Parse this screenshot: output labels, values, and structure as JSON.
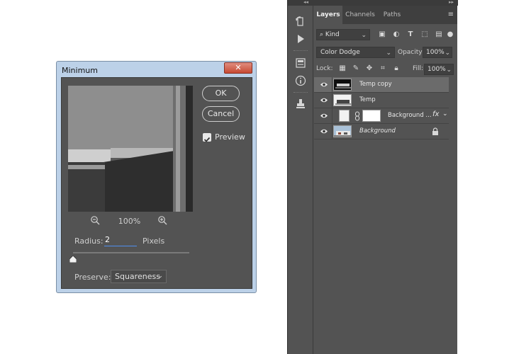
{
  "dialog": {
    "title": "Minimum",
    "close_label": "✕",
    "ok_label": "OK",
    "cancel_label": "Cancel",
    "preview_label": "Preview",
    "preview_checked": true,
    "zoom_value": "100%",
    "radius_label": "Radius:",
    "radius_value": "2",
    "radius_unit": "Pixels",
    "preserve_label": "Preserve:",
    "preserve_value": "Squareness"
  },
  "toolbar": {
    "collapse_left": "◂◂",
    "collapse_right": "▸▸",
    "tools": [
      "history-icon",
      "play-actions-icon",
      "properties-icon",
      "info-icon",
      "clone-source-icon"
    ]
  },
  "layers_panel": {
    "tabs": [
      {
        "label": "Layers",
        "active": true
      },
      {
        "label": "Channels",
        "active": false
      },
      {
        "label": "Paths",
        "active": false
      }
    ],
    "menu_icon": "≡",
    "filter_kind": "Kind",
    "blend_mode": "Color Dodge",
    "opacity_label": "Opacity:",
    "opacity_value": "100%",
    "lock_label": "Lock:",
    "fill_label": "Fill:",
    "fill_value": "100%",
    "layers": [
      {
        "name": "Temp copy",
        "visible": true,
        "selected": true,
        "italic": false
      },
      {
        "name": "Temp",
        "visible": true,
        "selected": false,
        "italic": false
      },
      {
        "name": "Background ...",
        "visible": true,
        "selected": false,
        "italic": false,
        "fx": "fx"
      },
      {
        "name": "Background",
        "visible": true,
        "selected": false,
        "italic": true,
        "locked": true
      }
    ]
  },
  "colors": {
    "panel_bg": "#535353",
    "dialog_frame": "#bcd1e8",
    "close_red": "#c74a33",
    "selected_layer": "#6b6b6b",
    "accent_blue": "#4f8ff0"
  }
}
